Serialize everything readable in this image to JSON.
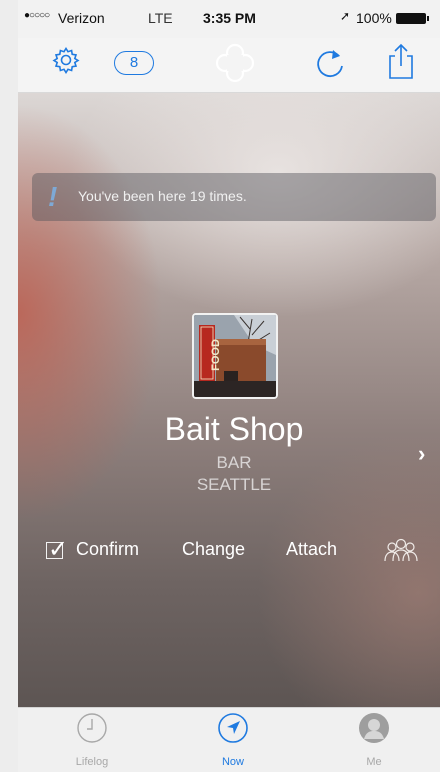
{
  "status_bar": {
    "signal": "●○○○○",
    "carrier": "Verizon",
    "network": "LTE",
    "time": "3:35 PM",
    "battery_text": "100%",
    "location_icon": "location-arrow-icon"
  },
  "nav_bar": {
    "settings_icon": "gear-icon",
    "count": "8",
    "logo_icon": "flower-logo-icon",
    "refresh_icon": "refresh-icon",
    "share_icon": "share-icon"
  },
  "banner": {
    "icon": "exclamation-icon",
    "message": "You've been here 19 times."
  },
  "place": {
    "name": "Bait Shop",
    "category": "BAR",
    "city": "SEATTLE",
    "sign_text": "FOOD"
  },
  "actions": {
    "confirm": "Confirm",
    "change": "Change",
    "attach": "Attach",
    "friends_icon": "people-icon"
  },
  "tabs": [
    {
      "label": "Lifelog",
      "icon": "clock-icon",
      "active": false
    },
    {
      "label": "Now",
      "icon": "navigation-arrow-icon",
      "active": true
    },
    {
      "label": "Me",
      "icon": "avatar-icon",
      "active": false
    }
  ],
  "colors": {
    "accent": "#1f7ae0",
    "inactive_tab": "#a8a8a8"
  }
}
